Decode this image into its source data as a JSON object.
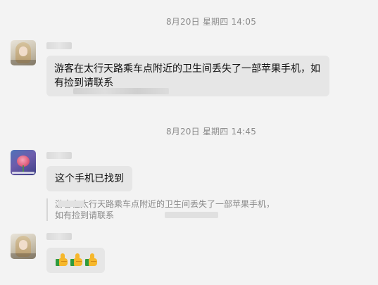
{
  "chat": {
    "timestamps": [
      "8月20日 星期四 14:05",
      "8月20日 星期四 14:45"
    ],
    "messages": [
      {
        "text": "游客在太行天路乘车点附近的卫生间丢失了一部苹果手机，如有捡到请联系"
      },
      {
        "text": "这个手机已找到",
        "quote": "游客在太行天路乘车点附近的卫生间丢失了一部苹果手机，如有捡到请联系"
      },
      {
        "emoji": "👍👍👍",
        "emoji_icons": [
          "thumbs-up-icon",
          "thumbs-up-icon",
          "thumbs-up-icon"
        ]
      }
    ]
  },
  "colors": {
    "background": "#f3f3f3",
    "bubble": "#e6e6e6",
    "timestamp_text": "#8a8a8a",
    "quote_text": "#8a8a8a"
  }
}
